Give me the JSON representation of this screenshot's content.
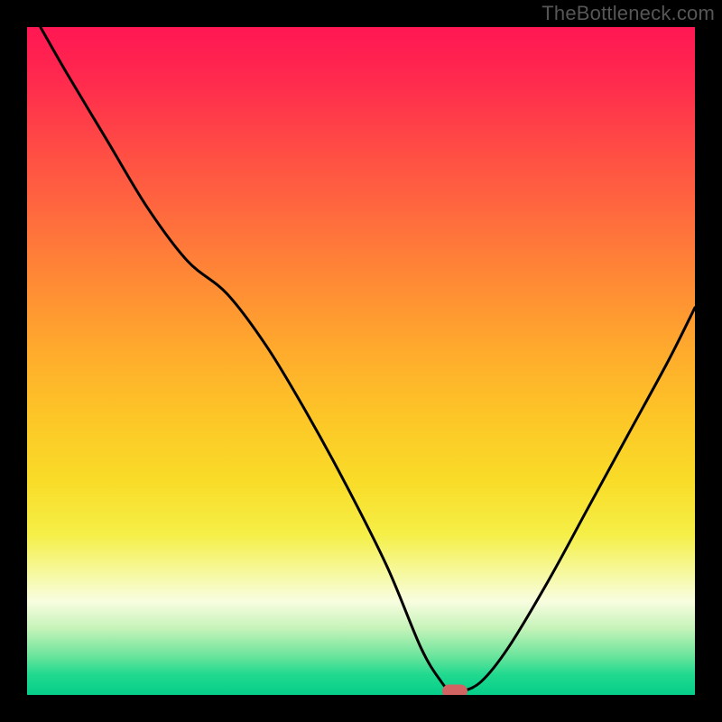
{
  "watermark": "TheBottleneck.com",
  "colors": {
    "frame": "#000000",
    "watermark_text": "#565656",
    "curve_stroke": "#000000",
    "marker_fill": "#d16363"
  },
  "chart_data": {
    "type": "line",
    "title": "",
    "xlabel": "",
    "ylabel": "",
    "xlim": [
      0,
      100
    ],
    "ylim": [
      0,
      100
    ],
    "grid": false,
    "legend": false,
    "series": [
      {
        "name": "bottleneck-curve",
        "x": [
          2,
          6,
          12,
          18,
          24,
          30,
          36,
          42,
          48,
          54,
          59,
          62,
          63.5,
          65,
          68,
          72,
          78,
          84,
          90,
          96,
          100
        ],
        "y": [
          100,
          93,
          83,
          73,
          65,
          60,
          52,
          42,
          31,
          19,
          7,
          2,
          0.5,
          0.5,
          2,
          7,
          17,
          28,
          39,
          50,
          58
        ]
      }
    ],
    "marker": {
      "x": 64,
      "y": 0.5
    },
    "gradient_stops": [
      {
        "pos": 0.0,
        "hex": "#ff1753"
      },
      {
        "pos": 0.08,
        "hex": "#ff2a4e"
      },
      {
        "pos": 0.18,
        "hex": "#ff4b45"
      },
      {
        "pos": 0.28,
        "hex": "#ff6a3e"
      },
      {
        "pos": 0.38,
        "hex": "#ff8a35"
      },
      {
        "pos": 0.48,
        "hex": "#ffa92d"
      },
      {
        "pos": 0.58,
        "hex": "#fdc527"
      },
      {
        "pos": 0.68,
        "hex": "#f9dc28"
      },
      {
        "pos": 0.76,
        "hex": "#f5ef47"
      },
      {
        "pos": 0.82,
        "hex": "#f6f9a3"
      },
      {
        "pos": 0.86,
        "hex": "#f8fde0"
      },
      {
        "pos": 0.9,
        "hex": "#c6f3b9"
      },
      {
        "pos": 0.94,
        "hex": "#6fe59d"
      },
      {
        "pos": 0.97,
        "hex": "#20d98f"
      },
      {
        "pos": 1.0,
        "hex": "#05ce89"
      }
    ]
  }
}
